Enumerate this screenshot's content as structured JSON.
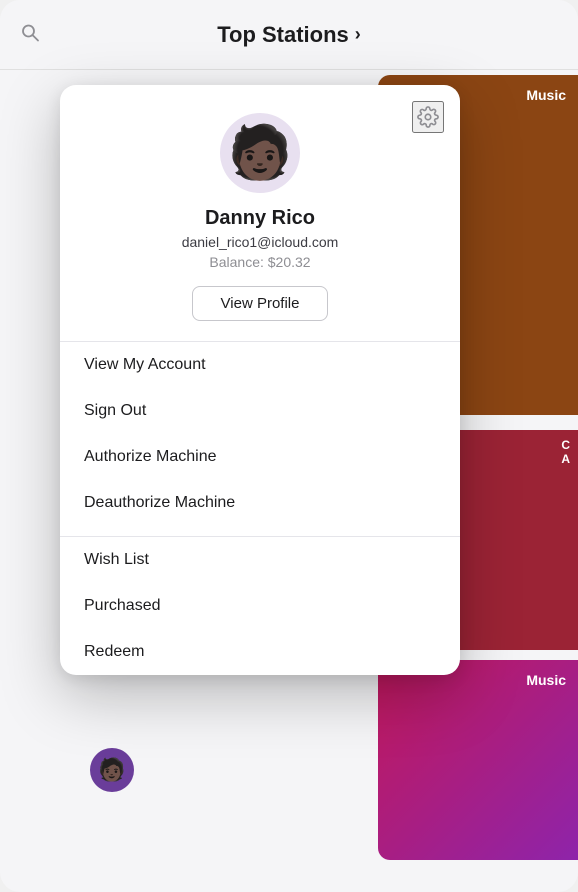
{
  "header": {
    "title": "Top Stations",
    "chevron": "›",
    "search_icon": "search"
  },
  "background": {
    "card1_label": "Music",
    "card2_label": "C\nA",
    "card3_label": "Music"
  },
  "profile": {
    "gear_icon": "gear",
    "user_name": "Danny Rico",
    "user_email": "daniel_rico1@icloud.com",
    "balance_label": "Balance: $20.32",
    "view_profile_label": "View Profile"
  },
  "menu": {
    "items_group1": [
      {
        "label": "View My Account"
      },
      {
        "label": "Sign Out"
      },
      {
        "label": "Authorize Machine"
      },
      {
        "label": "Deauthorize Machine"
      }
    ],
    "items_group2": [
      {
        "label": "Wish List"
      },
      {
        "label": "Purchased"
      },
      {
        "label": "Redeem"
      }
    ]
  }
}
